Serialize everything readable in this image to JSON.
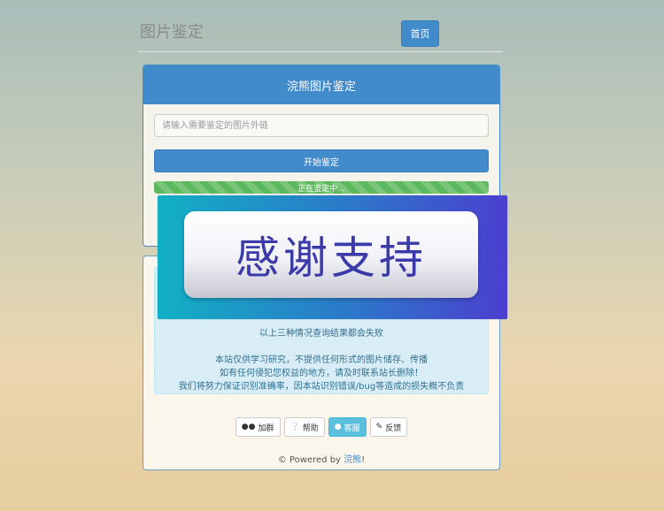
{
  "header": {
    "title": "图片鉴定",
    "home_button": "首页"
  },
  "panel": {
    "heading": "浣熊图片鉴定",
    "input_placeholder": "请输入需要鉴定的图片外链",
    "start_button": "开始鉴定",
    "progress_text": "正在鉴定中..."
  },
  "info": {
    "lines": [
      "以上三种情况查询结果都会失败",
      "本站仅供学习研究，不提供任何形式的图片储存、传播",
      "如有任何侵犯您权益的地方，请及时联系站长删除！",
      "我们将努力保证识别准确率，因本站识别错误/bug等造成的损失概不负责"
    ]
  },
  "buttons": {
    "join": {
      "label": "加群",
      "icon": "users-icon"
    },
    "help": {
      "label": "帮助",
      "icon": "question-icon"
    },
    "service": {
      "label": "客服",
      "icon": "user-icon"
    },
    "feedback": {
      "label": "反馈",
      "icon": "pencil-icon"
    }
  },
  "footer": {
    "prefix": "© Powered by ",
    "link": "浣熊",
    "suffix": "!"
  },
  "overlay": {
    "text": "感谢支持"
  },
  "colors": {
    "primary": "#428bca",
    "success": "#5cb85c",
    "info": "#5bc0de",
    "alert_bg": "#d9edf7",
    "alert_text": "#31708f"
  }
}
